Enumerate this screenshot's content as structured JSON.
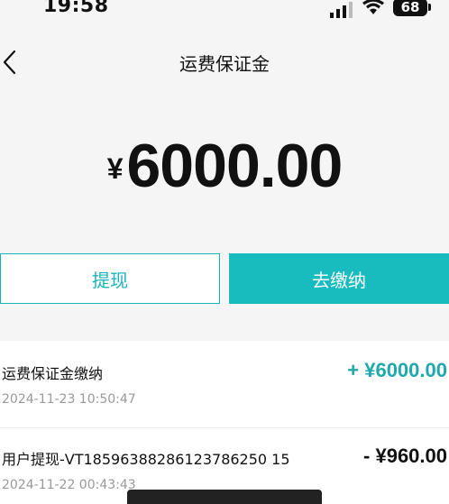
{
  "status_bar": {
    "time": "19:58",
    "battery": "68"
  },
  "header": {
    "title": "运费保证金"
  },
  "balance": {
    "currency_symbol": "¥",
    "amount": "6000.00"
  },
  "actions": {
    "withdraw_label": "提现",
    "pay_label": "去缴纳"
  },
  "records": [
    {
      "title": "运费保证金缴纳",
      "time": "2024-11-23 10:50:47",
      "amount": "+ ¥6000.00"
    },
    {
      "title": "用户提现-VT18596388286123786250 15",
      "time": "2024-11-22 00:43:43",
      "amount": "- ¥960.00"
    }
  ],
  "colors": {
    "accent": "#18bcbf",
    "income": "#1fa9ad"
  },
  "icons": [
    "back-icon",
    "signal-icon",
    "wifi-icon",
    "battery-icon"
  ]
}
